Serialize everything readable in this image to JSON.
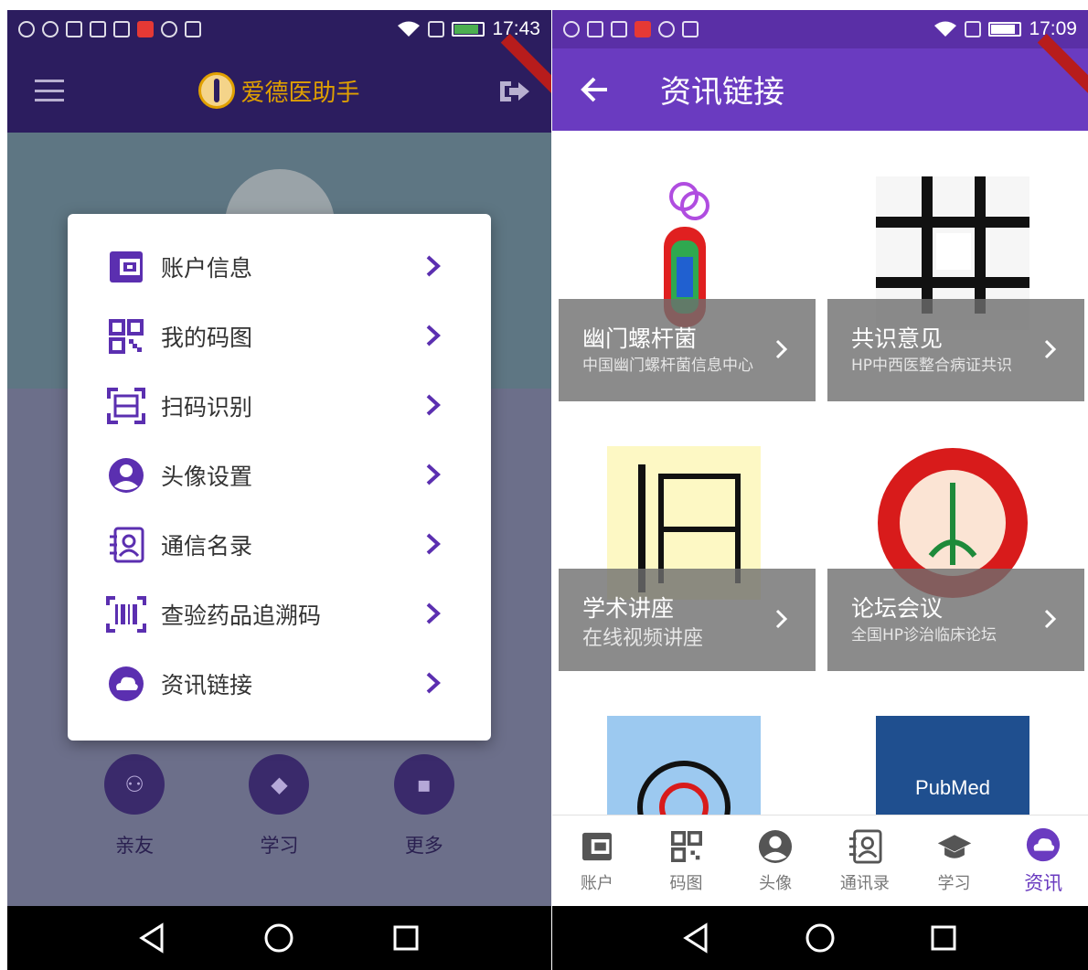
{
  "left": {
    "status": {
      "time": "17:43"
    },
    "app_title": "爱德医助手",
    "menu_items": [
      {
        "label": "账户信息",
        "icon": "wallet-icon"
      },
      {
        "label": "我的码图",
        "icon": "qrcode-icon"
      },
      {
        "label": "扫码识别",
        "icon": "scan-icon"
      },
      {
        "label": "头像设置",
        "icon": "avatar-icon"
      },
      {
        "label": "通信名录",
        "icon": "contacts-icon"
      },
      {
        "label": "查验药品追溯码",
        "icon": "barcode-icon"
      },
      {
        "label": "资讯链接",
        "icon": "cloud-icon"
      }
    ],
    "bottom_actions": [
      {
        "label": "亲友",
        "icon": "family-icon"
      },
      {
        "label": "学习",
        "icon": "graduation-cap-icon"
      },
      {
        "label": "更多",
        "icon": "chat-bubble-icon"
      }
    ]
  },
  "right": {
    "status": {
      "time": "17:09"
    },
    "title": "资讯链接",
    "cards": [
      {
        "title": "幽门螺杆菌",
        "subtitle": "中国幽门螺杆菌信息中心"
      },
      {
        "title": "共识意见",
        "subtitle": "HP中西医整合病证共识"
      },
      {
        "title": "学术讲座",
        "subtitle": "在线视频讲座"
      },
      {
        "title": "论坛会议",
        "subtitle": "全国HP诊治临床论坛"
      }
    ],
    "partial_tiles": {
      "pubmed_label": "PubMed"
    },
    "nav": [
      {
        "label": "账户",
        "icon": "wallet-icon"
      },
      {
        "label": "码图",
        "icon": "qrcode-icon"
      },
      {
        "label": "头像",
        "icon": "avatar-icon"
      },
      {
        "label": "通讯录",
        "icon": "contacts-icon"
      },
      {
        "label": "学习",
        "icon": "graduation-cap-icon"
      },
      {
        "label": "资讯",
        "icon": "cloud-icon",
        "active": true
      }
    ]
  },
  "colors": {
    "primary": "#6a3bc0",
    "dark_appbar": "#2c1d5f",
    "accent": "#e0a000"
  }
}
